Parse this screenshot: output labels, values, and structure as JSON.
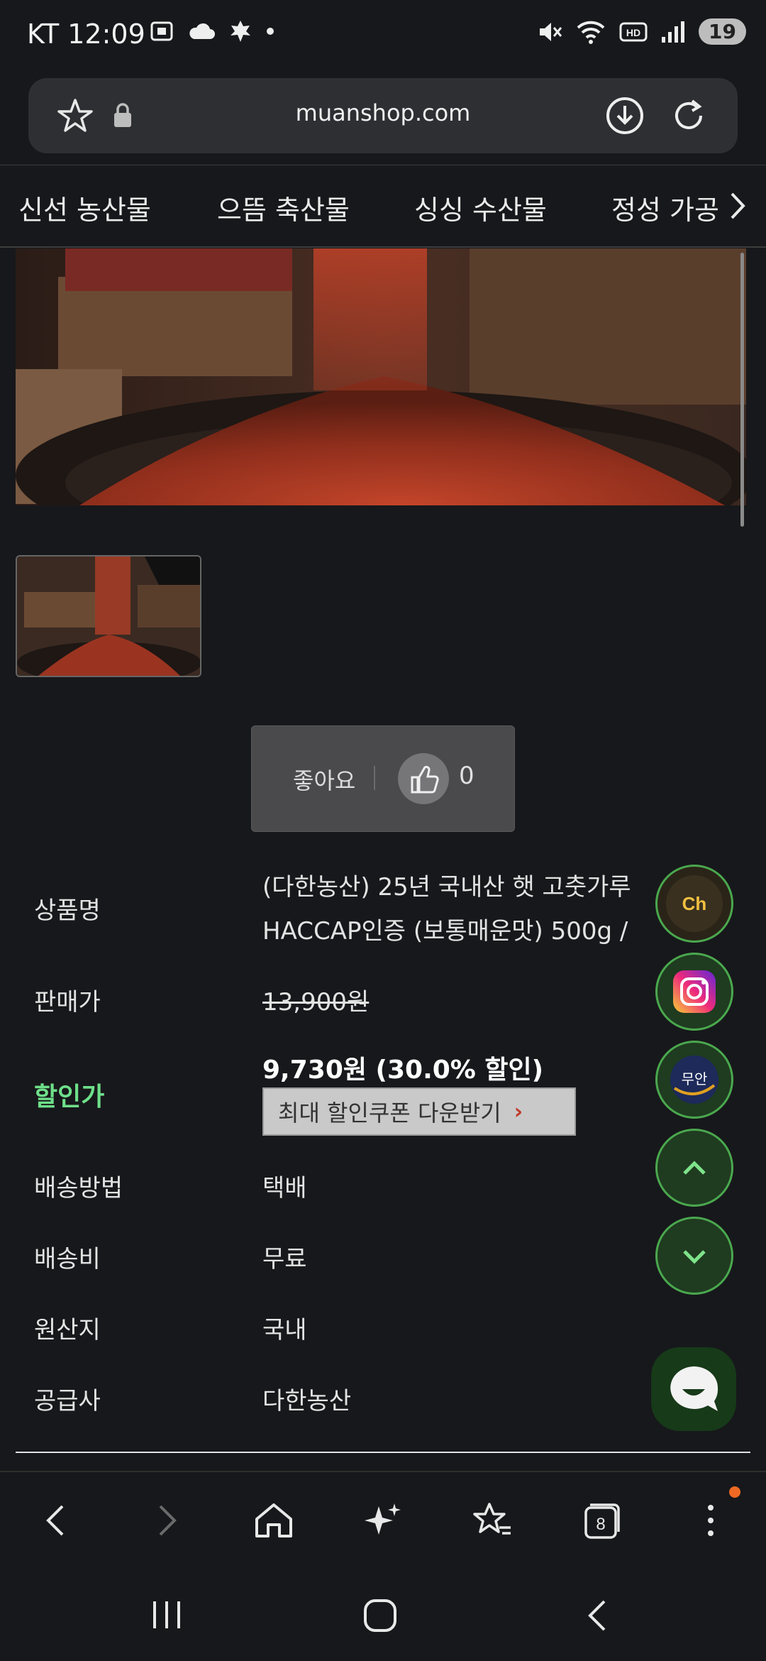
{
  "status_bar": {
    "carrier_time": "KT 12:09",
    "battery": "19"
  },
  "browser": {
    "url": "muanshop.com"
  },
  "categories": [
    "신선 농산물",
    "으뜸 축산물",
    "싱싱 수산물",
    "정성 가공"
  ],
  "like": {
    "label": "좋아요",
    "count": "0"
  },
  "product": {
    "name_label": "상품명",
    "name_line1": "(다한농산) 25년 국내산 햇 고춧가루",
    "name_line2": "HACCAP인증 (보통매운맛) 500g /",
    "price_label": "판매가",
    "price": "13,900원",
    "discount_label": "할인가",
    "discount_price": "9,730원 (30.0% 할인)",
    "coupon_button": "최대 할인쿠폰 다운받기",
    "shipping_method_label": "배송방법",
    "shipping_method": "택배",
    "shipping_fee_label": "배송비",
    "shipping_fee": "무료",
    "origin_label": "원산지",
    "origin": "국내",
    "supplier_label": "공급사",
    "supplier": "다한농산"
  },
  "floating": {
    "channel_text": "Ch",
    "muan_text": "무안"
  },
  "toolbar": {
    "tabs_count": "8"
  },
  "colors": {
    "accent_green": "#4aa84e",
    "discount_green": "#6ee08a",
    "notif": "#ee6a24"
  }
}
